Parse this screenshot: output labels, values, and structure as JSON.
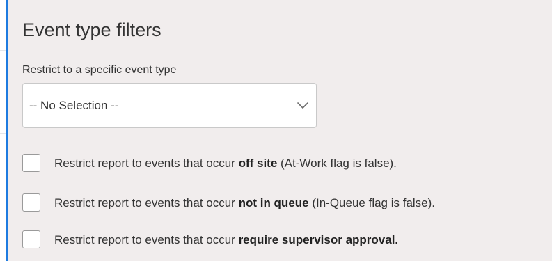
{
  "panel": {
    "title": "Event type filters"
  },
  "event_type_select": {
    "label": "Restrict to a specific event type",
    "selected": "-- No Selection --"
  },
  "options": [
    {
      "prefix": "Restrict report to events that occur ",
      "emphasis": "off site",
      "suffix": " (At-Work flag is false).",
      "checked": false
    },
    {
      "prefix": "Restrict report to events that occur ",
      "emphasis": "not in queue",
      "suffix": " (In-Queue flag is false).",
      "checked": false
    },
    {
      "prefix": "Restrict report to events that occur ",
      "emphasis": "require supervisor approval.",
      "suffix": "",
      "checked": false
    }
  ],
  "colors": {
    "panel_background": "#f1eded",
    "accent_border": "#1e7be0",
    "text": "#333333"
  },
  "icons": {
    "dropdown": "chevron-down-icon"
  }
}
